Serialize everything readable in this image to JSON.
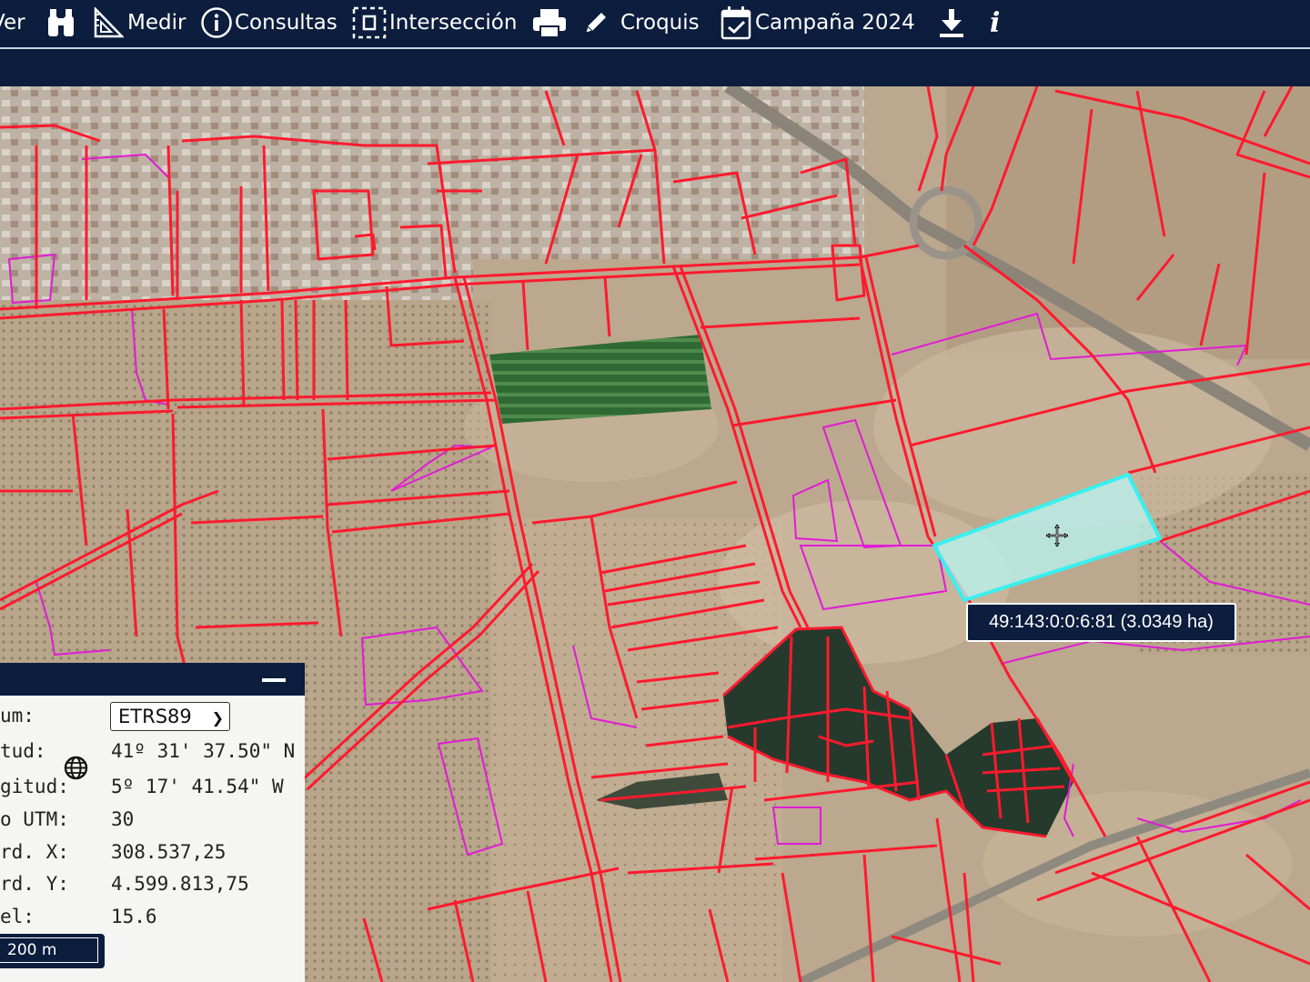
{
  "toolbar": {
    "ver_label": "Ver",
    "medir_label": "Medir",
    "consultas_label": "Consultas",
    "interseccion_label": "Intersección",
    "croquis_label": "Croquis",
    "campana_label": "Campaña 2024",
    "icons": [
      "binoculars-icon",
      "ruler-icon",
      "info-circle-icon",
      "intersection-icon",
      "print-icon",
      "pencil-icon",
      "calendar-icon",
      "download-icon",
      "info-icon"
    ]
  },
  "parcel_tooltip": "49:143:0:0:6:81 (3.0349 ha)",
  "coords_panel": {
    "datum_label": "um:",
    "datum_value": "ETRS89",
    "lat_label": "tud:",
    "lat_value": "41º 31' 37.50\" N",
    "lon_label": "gitud:",
    "lon_value": "5º 17' 41.54\" W",
    "utm_label": "o UTM:",
    "utm_value": "30",
    "x_label": "rd. X:",
    "x_value": "308.537,25",
    "y_label": "rd. Y:",
    "y_value": "4.599.813,75",
    "zoom_label": "el:",
    "zoom_value": "15.6",
    "scale_label": "200 m"
  },
  "colors": {
    "toolbar_bg": "#0c1d3d",
    "parcel_border": "#ff1a2e",
    "sigpac_border": "#e21bd6",
    "selected_parcel": "#39f0f0"
  }
}
